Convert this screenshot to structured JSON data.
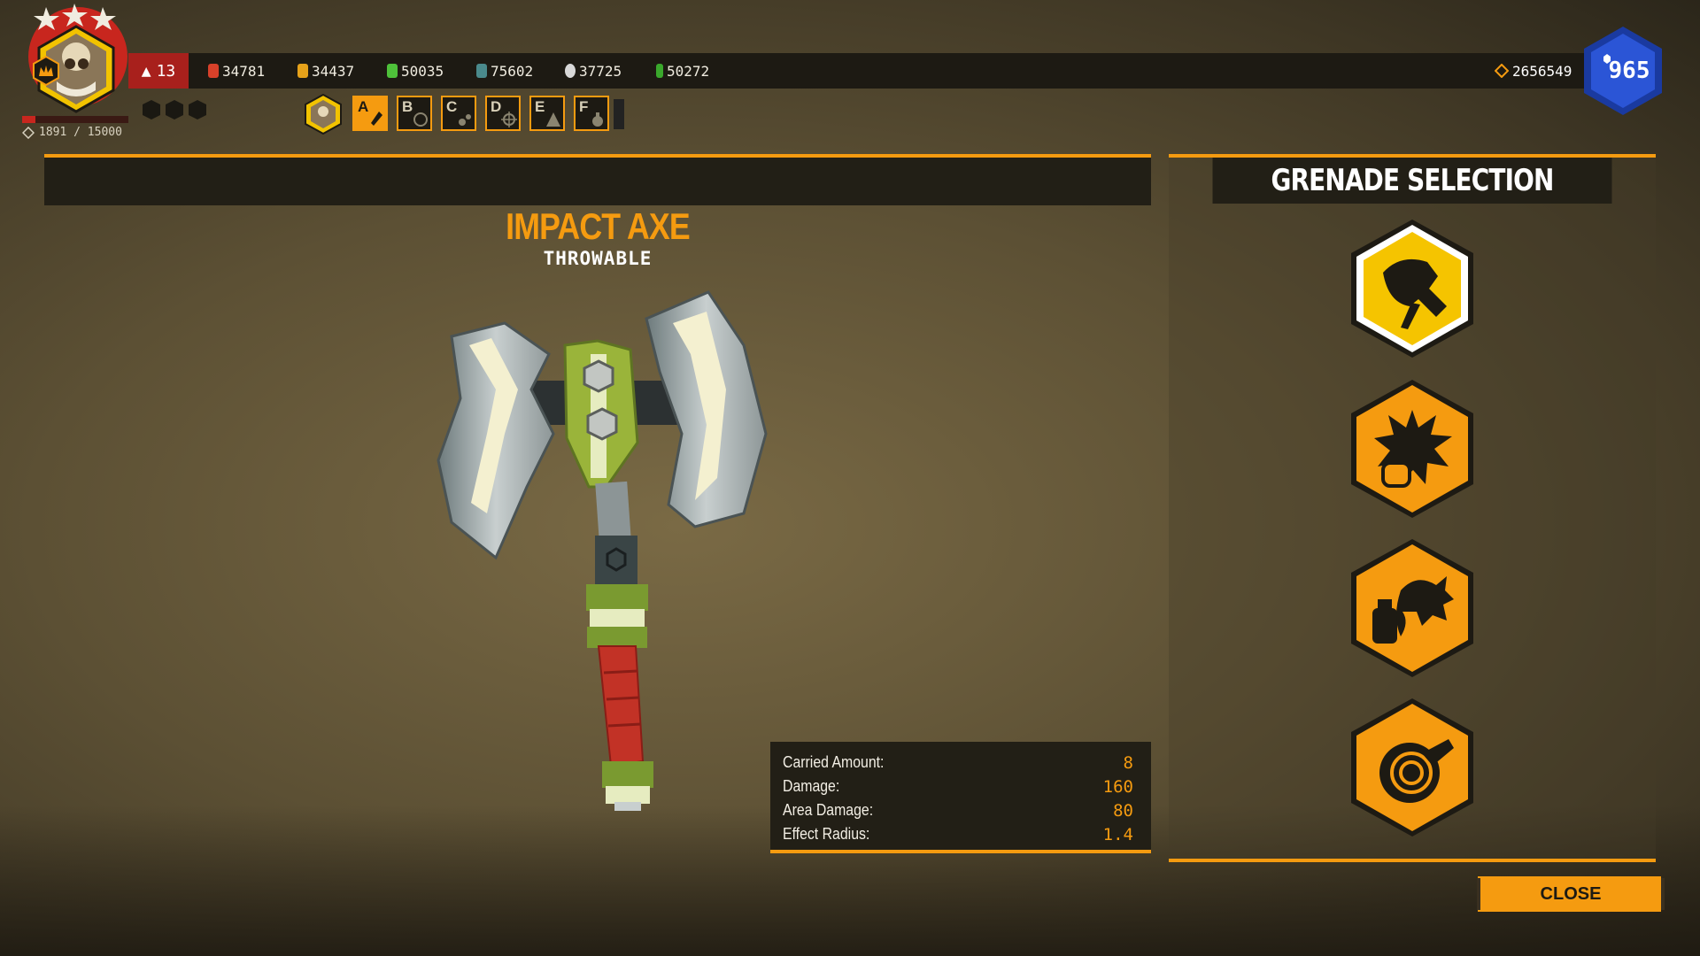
{
  "player": {
    "rank": "13",
    "xp_text": "1891 / 15000",
    "xp_fraction": 0.126
  },
  "resources": [
    {
      "name": "resource-red",
      "value": "34781",
      "color": "#d8412a"
    },
    {
      "name": "resource-gold",
      "value": "34437",
      "color": "#e6a21a"
    },
    {
      "name": "resource-green",
      "value": "50035",
      "color": "#4ec13a"
    },
    {
      "name": "resource-teal",
      "value": "75602",
      "color": "#4a8a8c"
    },
    {
      "name": "resource-silver",
      "value": "37725",
      "color": "#d8d8d8"
    },
    {
      "name": "resource-lime",
      "value": "50272",
      "color": "#3aa82c"
    }
  ],
  "credits": "2656549",
  "perk_points": "965",
  "loadout_tabs": [
    "A",
    "B",
    "C",
    "D",
    "E",
    "F"
  ],
  "item": {
    "name": "IMPACT AXE",
    "type": "THROWABLE"
  },
  "stats": [
    {
      "label": "Carried Amount:",
      "value": "8"
    },
    {
      "label": "Damage:",
      "value": "160"
    },
    {
      "label": "Area Damage:",
      "value": "80"
    },
    {
      "label": "Effect Radius:",
      "value": "1.4"
    }
  ],
  "panel": {
    "title": "GRENADE SELECTION"
  },
  "grenade_options": [
    {
      "icon": "impact-axe-icon",
      "selected": true
    },
    {
      "icon": "explosive-grenade-icon",
      "selected": false
    },
    {
      "icon": "cluster-grenade-icon",
      "selected": false
    },
    {
      "icon": "sawblade-grenade-icon",
      "selected": false
    }
  ],
  "close_label": "CLOSE",
  "colors": {
    "accent": "#f59b10",
    "panel": "#221f16",
    "rank": "#a8201c",
    "perk_hex": "#1a3aa0"
  }
}
